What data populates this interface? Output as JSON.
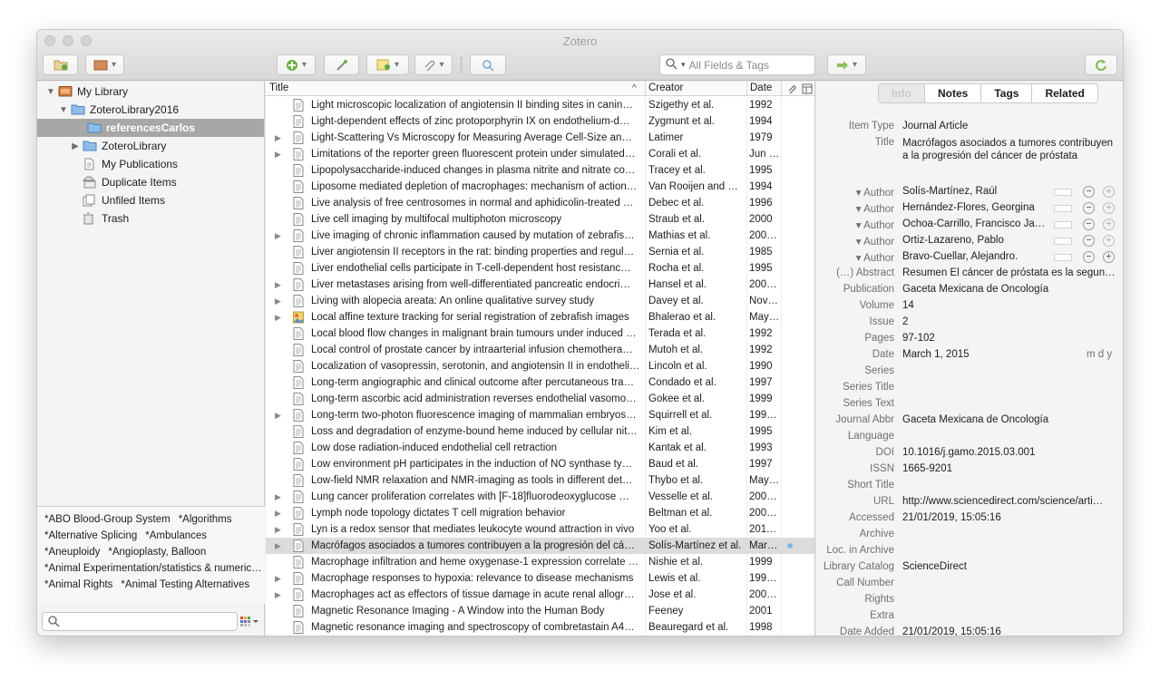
{
  "window": {
    "title": "Zotero"
  },
  "toolbar": {
    "search_placeholder": "All Fields & Tags"
  },
  "collections": [
    {
      "label": "My Library",
      "disclosure": "▼",
      "icon": "library-icon"
    },
    {
      "label": "ZoteroLibrary2016",
      "disclosure": "▼",
      "icon": "folder-icon"
    },
    {
      "label": "referencesCarlos",
      "disclosure": "",
      "icon": "folder-icon",
      "selected": true
    },
    {
      "label": "ZoteroLibrary",
      "disclosure": "▶",
      "icon": "folder-icon"
    },
    {
      "label": "My Publications",
      "disclosure": "",
      "icon": "publications-icon"
    },
    {
      "label": "Duplicate Items",
      "disclosure": "",
      "icon": "duplicate-icon"
    },
    {
      "label": "Unfiled Items",
      "disclosure": "",
      "icon": "unfiled-icon"
    },
    {
      "label": "Trash",
      "disclosure": "",
      "icon": "trash-icon"
    }
  ],
  "tags": [
    "*ABO Blood-Group System",
    "*Algorithms",
    "*Alternative Splicing",
    "*Ambulances",
    "*Aneuploidy",
    "*Angioplasty, Balloon",
    "*Animal Experimentation/statistics & numeric…",
    "*Animal Rights",
    "*Animal Testing Alternatives"
  ],
  "columns": {
    "title": "Title",
    "creator": "Creator",
    "date": "Date",
    "sort_indicator": "^"
  },
  "items": [
    {
      "disc": "",
      "title": "Light microscopic localization of angiotensin II binding sites in canin…",
      "creator": "Szigethy et al.",
      "date": "1992"
    },
    {
      "disc": "",
      "title": "Light-dependent effects of zinc protoporphyrin IX on endothelium-d…",
      "creator": "Zygmunt et al.",
      "date": "1994"
    },
    {
      "disc": "▶",
      "title": "Light-Scattering Vs Microscopy for Measuring Average Cell-Size an…",
      "creator": "Latimer",
      "date": "1979"
    },
    {
      "disc": "▶",
      "title": "Limitations of the reporter green fluorescent protein under simulated…",
      "creator": "Corali et al.",
      "date": "Jun …"
    },
    {
      "disc": "",
      "title": "Lipopolysaccharide-induced changes in plasma nitrite and nitrate co…",
      "creator": "Tracey et al.",
      "date": "1995"
    },
    {
      "disc": "",
      "title": "Liposome mediated depletion of macrophages: mechanism of action…",
      "creator": "Van Rooijen and S…",
      "date": "1994"
    },
    {
      "disc": "",
      "title": "Live analysis of free centrosomes in normal and aphidicolin-treated …",
      "creator": "Debec et al.",
      "date": "1996"
    },
    {
      "disc": "",
      "title": "Live cell imaging by multifocal multiphoton microscopy",
      "creator": "Straub et al.",
      "date": "2000"
    },
    {
      "disc": "▶",
      "title": "Live imaging of chronic inflammation caused by mutation of zebrafis…",
      "creator": "Mathias et al.",
      "date": "200…"
    },
    {
      "disc": "",
      "title": "Liver angiotensin II receptors in the rat: binding properties and regul…",
      "creator": "Sernia et al.",
      "date": "1985"
    },
    {
      "disc": "",
      "title": "Liver endothelial cells participate in T-cell-dependent host resistanc…",
      "creator": "Rocha et al.",
      "date": "1995"
    },
    {
      "disc": "▶",
      "title": "Liver metastases arising from well-differentiated pancreatic endocri…",
      "creator": "Hansel et al.",
      "date": "200…"
    },
    {
      "disc": "▶",
      "title": "Living with alopecia areata: An online qualitative survey study",
      "creator": "Davey et al.",
      "date": "Nov …"
    },
    {
      "disc": "▶",
      "title": "Local affine texture tracking for serial registration of zebrafish images",
      "creator": "Bhalerao et al.",
      "date": "May…",
      "special": true
    },
    {
      "disc": "",
      "title": "Local blood flow changes in malignant brain tumours under induced …",
      "creator": "Terada et al.",
      "date": "1992"
    },
    {
      "disc": "",
      "title": "Local control of prostate cancer by intraarterial infusion chemothera…",
      "creator": "Mutoh et al.",
      "date": "1992"
    },
    {
      "disc": "",
      "title": "Localization of vasopressin, serotonin, and angiotensin II in endotheli…",
      "creator": "Lincoln et al.",
      "date": "1990"
    },
    {
      "disc": "",
      "title": "Long-term angiographic and clinical outcome after percutaneous tra…",
      "creator": "Condado et al.",
      "date": "1997"
    },
    {
      "disc": "",
      "title": "Long-term ascorbic acid administration reverses endothelial vasomo…",
      "creator": "Gokee et al.",
      "date": "1999"
    },
    {
      "disc": "▶",
      "title": "Long-term two-photon fluorescence imaging of mammalian embryos…",
      "creator": "Squirrell et al.",
      "date": "199…"
    },
    {
      "disc": "",
      "title": "Loss and degradation of enzyme-bound heme induced by cellular nit…",
      "creator": "Kim et al.",
      "date": "1995"
    },
    {
      "disc": "",
      "title": "Low dose radiation-induced endothelial cell retraction",
      "creator": "Kantak et al.",
      "date": "1993"
    },
    {
      "disc": "",
      "title": "Low environment pH participates in the induction of NO synthase ty…",
      "creator": "Baud et al.",
      "date": "1997"
    },
    {
      "disc": "",
      "title": "Low-field NMR relaxation and NMR-imaging as tools in different det…",
      "creator": "Thybo et al.",
      "date": "May…"
    },
    {
      "disc": "▶",
      "title": "Lung cancer proliferation correlates with [F-18]fluorodeoxyglucose …",
      "creator": "Vesselle et al.",
      "date": "200…"
    },
    {
      "disc": "▶",
      "title": "Lymph node topology dictates T cell migration behavior",
      "creator": "Beltman et al.",
      "date": "200…"
    },
    {
      "disc": "▶",
      "title": "Lyn is a redox sensor that mediates leukocyte wound attraction in vivo",
      "creator": "Yoo et al.",
      "date": "2011…"
    },
    {
      "disc": "▶",
      "title": "Macrófagos asociados a tumores contribuyen a la progresión del cá…",
      "creator": "Solís-Martínez et al.",
      "date": "Mar…",
      "selected": true
    },
    {
      "disc": "",
      "title": "Macrophage infiltration and heme oxygenase-1 expression correlate …",
      "creator": "Nishie et al.",
      "date": "1999"
    },
    {
      "disc": "▶",
      "title": "Macrophage responses to hypoxia: relevance to disease mechanisms",
      "creator": "Lewis et al.",
      "date": "199…"
    },
    {
      "disc": "▶",
      "title": "Macrophages act as effectors of tissue damage in acute renal allogr…",
      "creator": "Jose et al.",
      "date": "200…"
    },
    {
      "disc": "",
      "title": "Magnetic Resonance Imaging - A Window into the Human Body",
      "creator": "Feeney",
      "date": "2001"
    },
    {
      "disc": "",
      "title": "Magnetic resonance imaging and spectroscopy of combretastain A4…",
      "creator": "Beauregard et al.",
      "date": "1998"
    }
  ],
  "tabs": [
    "Info",
    "Notes",
    "Tags",
    "Related"
  ],
  "info": {
    "fields": [
      {
        "label": "Item Type",
        "value": "Journal Article"
      },
      {
        "label": "Title",
        "value": "Macrófagos asociados a tumores contribuyen a la progresión del cáncer de próstata",
        "wrap": true
      },
      {
        "label": "▾ Author",
        "value": "Solís-Martínez, Raúl",
        "author": true
      },
      {
        "label": "▾ Author",
        "value": "Hernández-Flores, Georgina",
        "author": true
      },
      {
        "label": "▾ Author",
        "value": "Ochoa-Carrillo, Francisco Ja…",
        "author": true
      },
      {
        "label": "▾ Author",
        "value": "Ortiz-Lazareno, Pablo",
        "author": true
      },
      {
        "label": "▾ Author",
        "value": "Bravo-Cuellar, Alejandro.",
        "author": true,
        "plus_active": true
      },
      {
        "label": "(…) Abstract",
        "value": "Resumen El cáncer de próstata es la segun…"
      },
      {
        "label": "Publication",
        "value": "Gaceta Mexicana de Oncología"
      },
      {
        "label": "Volume",
        "value": "14"
      },
      {
        "label": "Issue",
        "value": "2"
      },
      {
        "label": "Pages",
        "value": "97-102"
      },
      {
        "label": "Date",
        "value": "March 1, 2015",
        "extra": "m d y"
      },
      {
        "label": "Series",
        "value": ""
      },
      {
        "label": "Series Title",
        "value": ""
      },
      {
        "label": "Series Text",
        "value": ""
      },
      {
        "label": "Journal Abbr",
        "value": "Gaceta Mexicana de Oncología"
      },
      {
        "label": "Language",
        "value": ""
      },
      {
        "label": "DOI",
        "value": "10.1016/j.gamo.2015.03.001"
      },
      {
        "label": "ISSN",
        "value": "1665-9201"
      },
      {
        "label": "Short Title",
        "value": ""
      },
      {
        "label": "URL",
        "value": "http://www.sciencedirect.com/science/arti…"
      },
      {
        "label": "Accessed",
        "value": "21/01/2019, 15:05:16"
      },
      {
        "label": "Archive",
        "value": ""
      },
      {
        "label": "Loc. in Archive",
        "value": ""
      },
      {
        "label": "Library Catalog",
        "value": "ScienceDirect"
      },
      {
        "label": "Call Number",
        "value": ""
      },
      {
        "label": "Rights",
        "value": ""
      },
      {
        "label": "Extra",
        "value": ""
      },
      {
        "label": "Date Added",
        "value": "21/01/2019, 15:05:16"
      }
    ]
  }
}
